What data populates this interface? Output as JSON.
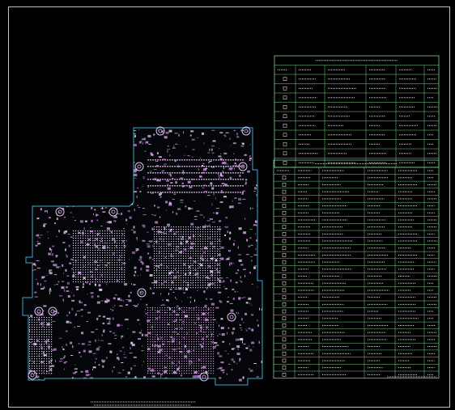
{
  "document": {
    "type": "PCB layout drawing",
    "background": "#000000",
    "border_color": "#bfbfbf",
    "board_outline_color": "#3fa7c9",
    "component_color": "#c58bd6",
    "pad_color": "#d6c7e8",
    "table_line_color": "#7fd08a",
    "table_text_color": "#d8d8d8"
  },
  "tables": [
    {
      "name": "drill-table-upper",
      "header_rows": 2,
      "rows": 12,
      "columns": 6
    },
    {
      "name": "drill-table-lower",
      "header_rows": 2,
      "rows": 30,
      "columns": 6
    }
  ],
  "board": {
    "icon": "pcb-board-icon",
    "mounting_holes": 12
  }
}
